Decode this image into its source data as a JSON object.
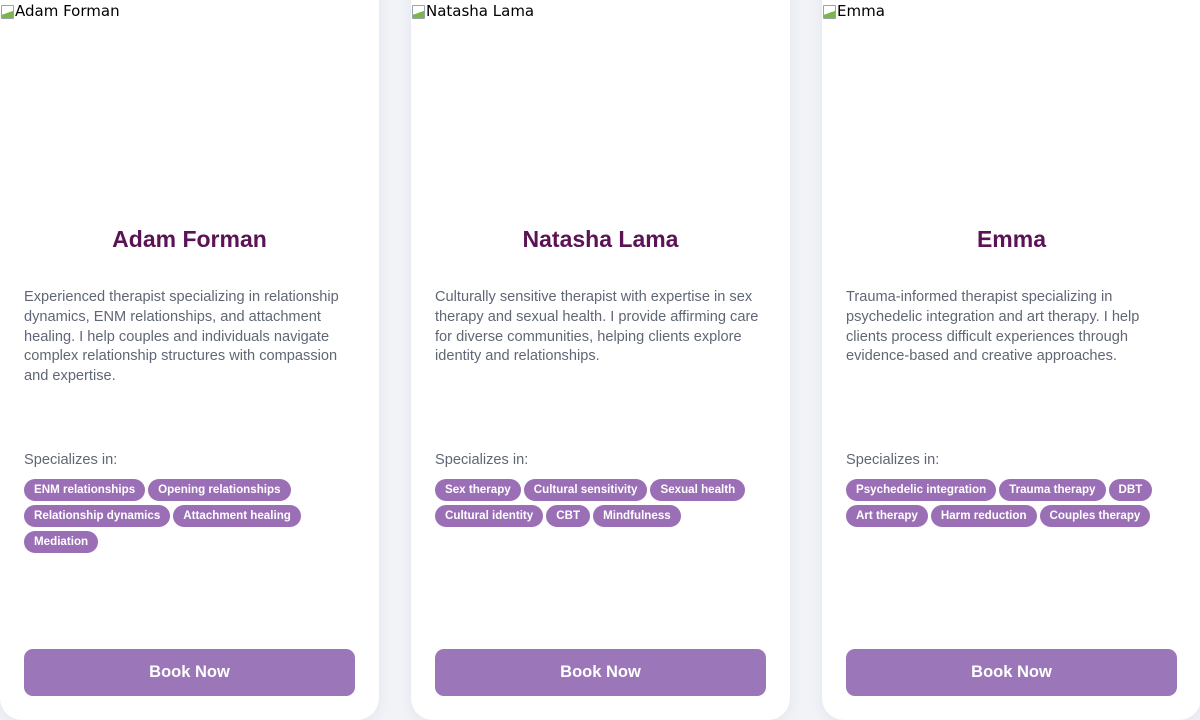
{
  "therapists": [
    {
      "image_alt": "Adam Forman",
      "name": "Adam Forman",
      "bio": "Experienced therapist specializing in relationship dynamics, ENM relationships, and attachment healing. I help couples and individuals navigate complex relationship structures with compassion and expertise.",
      "specializes_label": "Specializes in:",
      "tags": [
        "ENM relationships",
        "Opening relationships",
        "Relationship dynamics",
        "Attachment healing",
        "Mediation"
      ],
      "button_label": "Book Now"
    },
    {
      "image_alt": "Natasha Lama",
      "name": "Natasha Lama",
      "bio": "Culturally sensitive therapist with expertise in sex therapy and sexual health. I provide affirming care for diverse communities, helping clients explore identity and relationships.",
      "specializes_label": "Specializes in:",
      "tags": [
        "Sex therapy",
        "Cultural sensitivity",
        "Sexual health",
        "Cultural identity",
        "CBT",
        "Mindfulness"
      ],
      "button_label": "Book Now"
    },
    {
      "image_alt": "Emma",
      "name": "Emma",
      "bio": "Trauma-informed therapist specializing in psychedelic integration and art therapy. I help clients process difficult experiences through evidence-based and creative approaches.",
      "specializes_label": "Specializes in:",
      "tags": [
        "Psychedelic integration",
        "Trauma therapy",
        "DBT",
        "Art therapy",
        "Harm reduction",
        "Couples therapy"
      ],
      "button_label": "Book Now"
    }
  ],
  "colors": {
    "name": "#5b1355",
    "tag_bg": "#9b6fb5",
    "button_bg": "#9b77b9",
    "body_text": "#606774",
    "page_bg": "#f1f3f7"
  },
  "icons": {
    "photo_placeholder": "broken-image-icon"
  }
}
